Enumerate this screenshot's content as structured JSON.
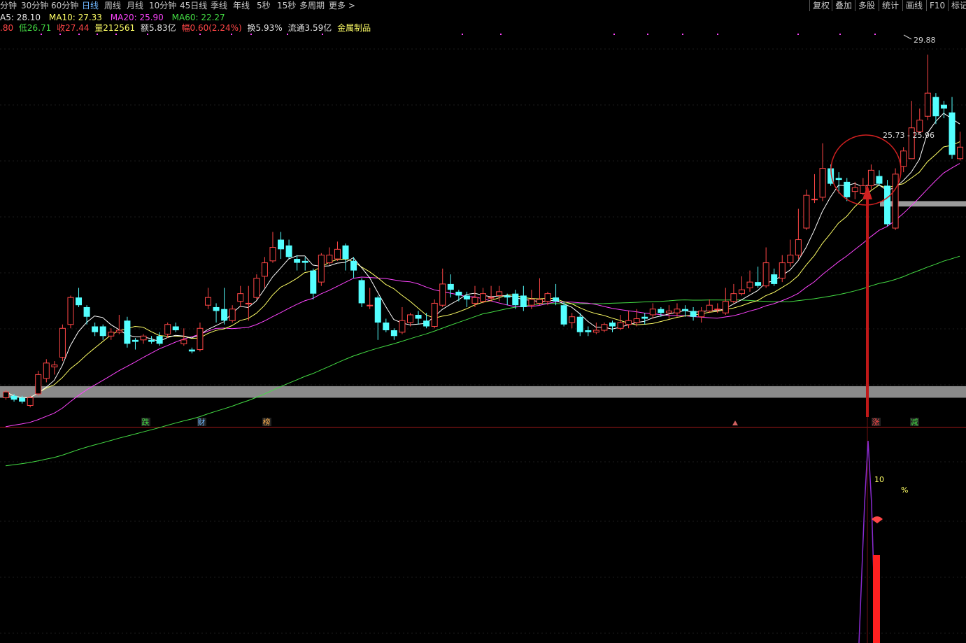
{
  "toolbar": {
    "periods": [
      "分钟",
      "30分钟",
      "60分钟",
      "日线",
      "周线",
      "月线",
      "10分钟",
      "45日线",
      "季线",
      "年线",
      "5秒",
      "15秒",
      "多周期",
      "更多 >"
    ],
    "active_period": "日线",
    "right_tools": [
      "复权",
      "叠加",
      "多股",
      "统计",
      "画线",
      "F10",
      "标记"
    ]
  },
  "ma_legend": {
    "ma5": "A5: 28.10",
    "ma10": "MA10: 27.33",
    "ma20": "MA20: 25.90",
    "ma60": "MA60: 22.27"
  },
  "quote_info": {
    "high_tail": ".80",
    "low": "低26.71",
    "close": "收27.44",
    "volume": "量212561",
    "amount": "额5.83亿",
    "change": "幅0.60(2.24%)",
    "turnover": "换5.93%",
    "float_cap": "流通3.59亿",
    "sector": "金属制品"
  },
  "colors": {
    "up": "#ff4646",
    "down": "#54ffff",
    "ma5": "#ffffff",
    "ma10": "#ffff66",
    "ma20": "#ff44ff",
    "ma60": "#44dd44",
    "panel_border": "#a01818"
  },
  "annotations": {
    "high_price": "29.88",
    "zone_label": "25.73 - 25.96",
    "indicator_value": "10",
    "indicator_unit": "%"
  },
  "event_markers": [
    "跌",
    "财",
    "榜",
    "涨",
    "减"
  ],
  "chart_data": {
    "type": "candlestick",
    "series": [
      "MA5",
      "MA10",
      "MA20",
      "MA60"
    ],
    "ylim": [
      20.5,
      30.3
    ],
    "candles": [
      [
        21.0,
        21.15,
        21.2,
        20.95
      ],
      [
        21.05,
        20.95,
        21.1,
        20.9
      ],
      [
        21.0,
        20.9,
        21.05,
        20.85
      ],
      [
        20.8,
        21.0,
        21.05,
        20.75
      ],
      [
        21.1,
        21.6,
        21.7,
        21.05
      ],
      [
        21.5,
        21.9,
        22.0,
        21.4
      ],
      [
        21.8,
        21.85,
        21.95,
        21.6
      ],
      [
        22.05,
        22.8,
        22.9,
        21.95
      ],
      [
        22.9,
        23.6,
        23.65,
        22.8
      ],
      [
        23.6,
        23.4,
        23.85,
        23.35
      ],
      [
        23.35,
        23.1,
        23.4,
        22.9
      ],
      [
        22.85,
        22.7,
        22.95,
        22.6
      ],
      [
        22.85,
        22.6,
        22.9,
        22.5
      ],
      [
        22.6,
        22.7,
        22.8,
        22.5
      ],
      [
        22.7,
        22.75,
        23.15,
        22.65
      ],
      [
        23.0,
        22.4,
        23.1,
        22.3
      ],
      [
        22.5,
        22.45,
        22.55,
        22.25
      ],
      [
        22.5,
        22.6,
        22.65,
        22.4
      ],
      [
        22.5,
        22.45,
        22.6,
        22.4
      ],
      [
        22.6,
        22.4,
        22.7,
        22.35
      ],
      [
        22.65,
        22.9,
        22.95,
        22.55
      ],
      [
        22.85,
        22.75,
        22.95,
        22.7
      ],
      [
        22.4,
        22.5,
        22.8,
        22.35
      ],
      [
        22.25,
        22.2,
        22.3,
        22.15
      ],
      [
        22.25,
        22.8,
        22.95,
        22.2
      ],
      [
        23.4,
        23.6,
        23.85,
        23.3
      ],
      [
        23.35,
        23.25,
        23.45,
        22.95
      ],
      [
        23.3,
        23.0,
        23.85,
        22.9
      ],
      [
        23.0,
        23.3,
        23.4,
        22.95
      ],
      [
        23.5,
        23.7,
        23.9,
        23.35
      ],
      [
        23.45,
        23.45,
        23.9,
        23.0
      ],
      [
        23.6,
        24.1,
        24.2,
        23.55
      ],
      [
        24.15,
        24.5,
        24.65,
        23.85
      ],
      [
        24.55,
        24.9,
        25.3,
        24.5
      ],
      [
        25.1,
        24.85,
        25.3,
        24.6
      ],
      [
        24.95,
        24.65,
        25.1,
        24.6
      ],
      [
        24.6,
        24.5,
        24.7,
        24.3
      ],
      [
        24.55,
        24.5,
        24.65,
        24.3
      ],
      [
        24.3,
        23.7,
        24.35,
        23.55
      ],
      [
        24.0,
        24.7,
        24.75,
        23.9
      ],
      [
        24.5,
        24.7,
        24.9,
        24.45
      ],
      [
        24.6,
        24.85,
        25.05,
        24.55
      ],
      [
        24.95,
        24.6,
        25.0,
        24.3
      ],
      [
        24.55,
        24.3,
        24.65,
        24.1
      ],
      [
        24.05,
        23.45,
        24.1,
        23.35
      ],
      [
        23.4,
        23.4,
        23.85,
        23.3
      ],
      [
        23.6,
        22.95,
        23.65,
        22.5
      ],
      [
        22.95,
        22.75,
        23.05,
        22.7
      ],
      [
        22.75,
        22.6,
        22.8,
        22.5
      ],
      [
        22.7,
        23.0,
        23.35,
        22.65
      ],
      [
        22.95,
        23.15,
        23.2,
        22.85
      ],
      [
        23.15,
        23.05,
        23.25,
        22.9
      ],
      [
        23.0,
        22.85,
        23.2,
        22.8
      ],
      [
        22.85,
        23.45,
        23.55,
        22.8
      ],
      [
        23.4,
        23.95,
        24.35,
        23.35
      ],
      [
        23.95,
        23.8,
        24.2,
        23.6
      ],
      [
        23.75,
        23.65,
        23.8,
        23.5
      ],
      [
        23.65,
        23.55,
        23.75,
        23.35
      ],
      [
        23.45,
        23.6,
        23.9,
        23.35
      ],
      [
        23.5,
        23.7,
        23.85,
        23.45
      ],
      [
        23.6,
        23.6,
        23.9,
        23.5
      ],
      [
        23.65,
        23.75,
        23.9,
        23.5
      ],
      [
        23.65,
        23.6,
        23.7,
        23.4
      ],
      [
        23.7,
        23.4,
        23.8,
        23.3
      ],
      [
        23.65,
        23.35,
        23.9,
        23.25
      ],
      [
        23.4,
        23.55,
        23.8,
        23.3
      ],
      [
        23.45,
        23.55,
        24.1,
        23.4
      ],
      [
        23.5,
        23.7,
        23.75,
        23.4
      ],
      [
        23.6,
        23.5,
        23.95,
        23.4
      ],
      [
        23.4,
        22.9,
        23.5,
        22.85
      ],
      [
        22.95,
        23.1,
        23.2,
        22.8
      ],
      [
        23.1,
        22.7,
        23.2,
        22.6
      ],
      [
        22.75,
        22.7,
        22.85,
        22.6
      ],
      [
        22.7,
        22.75,
        22.95,
        22.65
      ],
      [
        22.75,
        22.9,
        22.95,
        22.7
      ],
      [
        22.95,
        22.85,
        23.0,
        22.7
      ],
      [
        22.8,
        22.95,
        23.15,
        22.75
      ],
      [
        22.9,
        23.0,
        23.25,
        22.8
      ],
      [
        22.95,
        23.05,
        23.3,
        22.85
      ],
      [
        23.1,
        23.05,
        23.2,
        22.9
      ],
      [
        23.15,
        23.3,
        23.45,
        23.05
      ],
      [
        23.3,
        23.2,
        23.35,
        23.1
      ],
      [
        23.2,
        23.25,
        23.4,
        23.05
      ],
      [
        23.2,
        23.3,
        23.45,
        23.1
      ],
      [
        23.3,
        23.25,
        23.4,
        23.1
      ],
      [
        23.25,
        23.1,
        23.35,
        23.0
      ],
      [
        23.1,
        23.25,
        23.35,
        22.95
      ],
      [
        23.25,
        23.4,
        23.55,
        23.2
      ],
      [
        23.3,
        23.3,
        23.45,
        23.2
      ],
      [
        23.2,
        23.5,
        23.85,
        23.15
      ],
      [
        23.5,
        23.7,
        23.95,
        23.45
      ],
      [
        23.7,
        23.8,
        24.15,
        23.65
      ],
      [
        23.85,
        24.0,
        24.3,
        23.75
      ],
      [
        24.0,
        23.9,
        24.4,
        23.85
      ],
      [
        23.9,
        24.5,
        24.9,
        23.85
      ],
      [
        24.2,
        23.95,
        24.35,
        23.9
      ],
      [
        24.1,
        24.5,
        24.7,
        24.0
      ],
      [
        24.5,
        24.7,
        25.1,
        24.4
      ],
      [
        24.7,
        25.1,
        25.9,
        24.6
      ],
      [
        25.4,
        26.25,
        26.4,
        25.35
      ],
      [
        26.15,
        26.15,
        26.8,
        26.05
      ],
      [
        26.2,
        26.95,
        27.6,
        26.1
      ],
      [
        26.95,
        26.55,
        27.05,
        26.5
      ],
      [
        26.7,
        26.65,
        26.85,
        26.3
      ],
      [
        26.6,
        26.2,
        26.7,
        26.1
      ],
      [
        26.35,
        26.45,
        26.6,
        26.15
      ],
      [
        26.3,
        26.5,
        26.7,
        26.25
      ],
      [
        26.5,
        26.9,
        27.05,
        26.4
      ],
      [
        26.75,
        26.55,
        26.9,
        26.5
      ],
      [
        26.5,
        25.5,
        26.65,
        25.45
      ],
      [
        25.4,
        26.8,
        26.95,
        25.35
      ],
      [
        27.0,
        27.4,
        27.5,
        26.85
      ],
      [
        27.2,
        28.0,
        28.7,
        27.2
      ],
      [
        27.9,
        28.2,
        28.5,
        27.85
      ],
      [
        28.3,
        28.9,
        29.9,
        28.2
      ],
      [
        28.8,
        28.3,
        28.9,
        28.1
      ],
      [
        28.6,
        28.5,
        28.7,
        28.25
      ],
      [
        28.4,
        27.3,
        28.8,
        27.2
      ],
      [
        27.2,
        27.5,
        27.9,
        27.15
      ]
    ]
  }
}
